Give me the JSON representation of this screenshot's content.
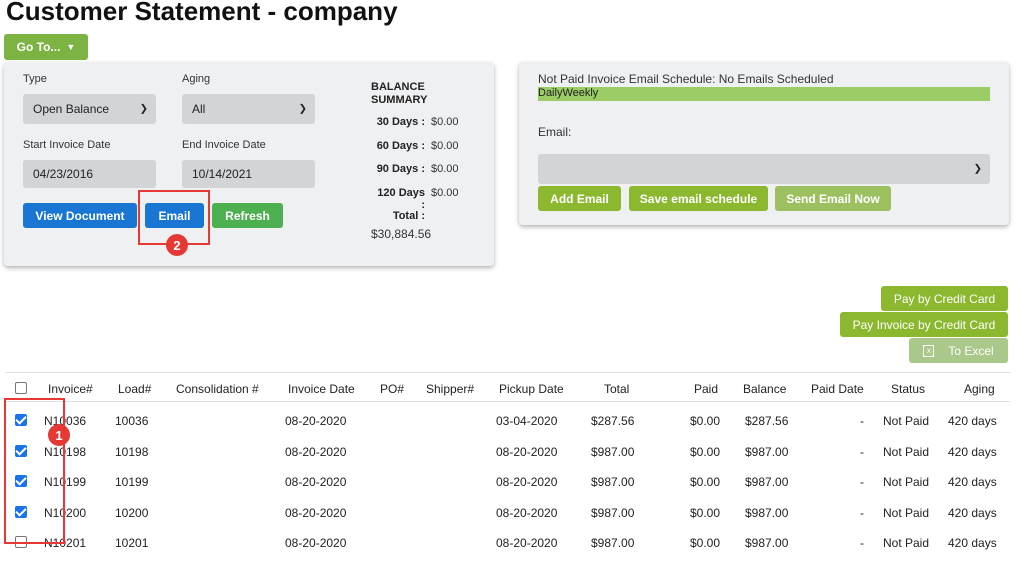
{
  "page_title": "Customer Statement - company",
  "goto": {
    "label": "Go To...",
    "icon": "caret-down-icon"
  },
  "filters": {
    "type_label": "Type",
    "type_value": "Open Balance",
    "aging_label": "Aging",
    "aging_value": "All",
    "start_label": "Start Invoice Date",
    "start_value": "04/23/2016",
    "end_label": "End Invoice Date",
    "end_value": "10/14/2021",
    "view_button": "View Document",
    "email_button": "Email",
    "refresh_button": "Refresh"
  },
  "balance_summary": {
    "title": "BALANCE SUMMARY",
    "rows": [
      {
        "label": "30 Days :",
        "value": "$0.00"
      },
      {
        "label": "60 Days :",
        "value": "$0.00"
      },
      {
        "label": "90 Days :",
        "value": "$0.00"
      },
      {
        "label": "120 Days :",
        "value": "$0.00"
      }
    ],
    "total_label": "Total :",
    "total_value": "$30,884.56"
  },
  "email_schedule": {
    "status": "Not Paid Invoice Email Schedule: No Emails Scheduled",
    "frequency": "DailyWeekly",
    "email_label": "Email:",
    "email_value": "",
    "add_button": "Add Email",
    "save_button": "Save email schedule",
    "send_button": "Send Email Now"
  },
  "actions": {
    "pay_cc": "Pay by Credit Card",
    "pay_invoice_cc": "Pay Invoice by Credit Card",
    "to_excel": "To Excel"
  },
  "annotations": {
    "badge1": "1",
    "badge2": "2"
  },
  "table": {
    "headers": [
      "Invoice#",
      "Load#",
      "Consolidation #",
      "Invoice Date",
      "PO#",
      "Shipper#",
      "Pickup Date",
      "Total",
      "Paid",
      "Balance",
      "Paid Date",
      "Status",
      "Aging"
    ],
    "rows": [
      {
        "checked": true,
        "invoice": "N10036",
        "load": "10036",
        "consolidation": "",
        "invoice_date": "08-20-2020",
        "po": "",
        "shipper": "",
        "pickup": "03-04-2020",
        "total": "$287.56",
        "paid": "$0.00",
        "balance": "$287.56",
        "paid_date": "-",
        "status": "Not Paid",
        "aging": "420 days"
      },
      {
        "checked": true,
        "invoice": "N10198",
        "load": "10198",
        "consolidation": "",
        "invoice_date": "08-20-2020",
        "po": "",
        "shipper": "",
        "pickup": "08-20-2020",
        "total": "$987.00",
        "paid": "$0.00",
        "balance": "$987.00",
        "paid_date": "-",
        "status": "Not Paid",
        "aging": "420 days"
      },
      {
        "checked": true,
        "invoice": "N10199",
        "load": "10199",
        "consolidation": "",
        "invoice_date": "08-20-2020",
        "po": "",
        "shipper": "",
        "pickup": "08-20-2020",
        "total": "$987.00",
        "paid": "$0.00",
        "balance": "$987.00",
        "paid_date": "-",
        "status": "Not Paid",
        "aging": "420 days"
      },
      {
        "checked": true,
        "invoice": "N10200",
        "load": "10200",
        "consolidation": "",
        "invoice_date": "08-20-2020",
        "po": "",
        "shipper": "",
        "pickup": "08-20-2020",
        "total": "$987.00",
        "paid": "$0.00",
        "balance": "$987.00",
        "paid_date": "-",
        "status": "Not Paid",
        "aging": "420 days"
      },
      {
        "checked": false,
        "invoice": "N10201",
        "load": "10201",
        "consolidation": "",
        "invoice_date": "08-20-2020",
        "po": "",
        "shipper": "",
        "pickup": "08-20-2020",
        "total": "$987.00",
        "paid": "$0.00",
        "balance": "$987.00",
        "paid_date": "-",
        "status": "Not Paid",
        "aging": "420 days"
      }
    ]
  }
}
